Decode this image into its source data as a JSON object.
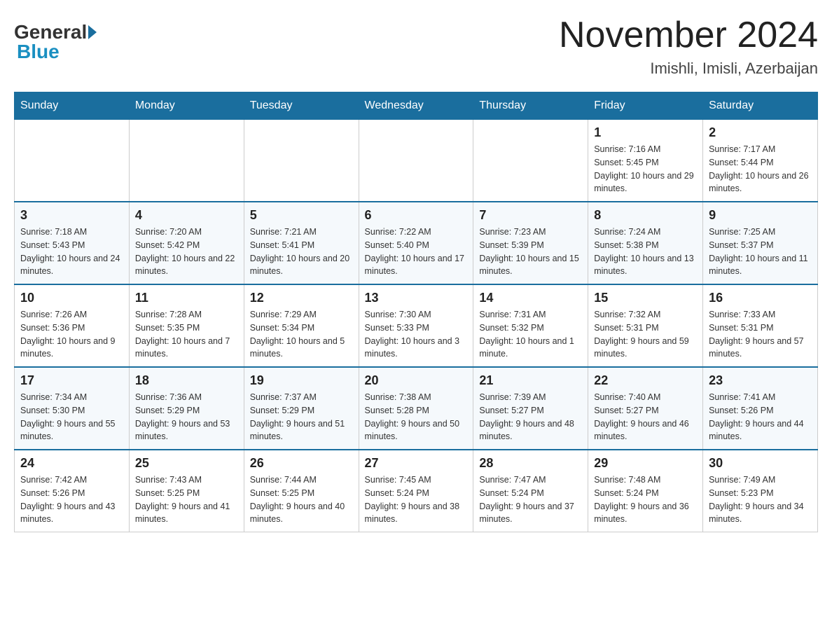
{
  "header": {
    "logo_general": "General",
    "logo_blue": "Blue",
    "title": "November 2024",
    "subtitle": "Imishli, Imisli, Azerbaijan"
  },
  "days_of_week": [
    "Sunday",
    "Monday",
    "Tuesday",
    "Wednesday",
    "Thursday",
    "Friday",
    "Saturday"
  ],
  "weeks": [
    {
      "days": [
        {
          "number": "",
          "info": ""
        },
        {
          "number": "",
          "info": ""
        },
        {
          "number": "",
          "info": ""
        },
        {
          "number": "",
          "info": ""
        },
        {
          "number": "",
          "info": ""
        },
        {
          "number": "1",
          "info": "Sunrise: 7:16 AM\nSunset: 5:45 PM\nDaylight: 10 hours and 29 minutes."
        },
        {
          "number": "2",
          "info": "Sunrise: 7:17 AM\nSunset: 5:44 PM\nDaylight: 10 hours and 26 minutes."
        }
      ]
    },
    {
      "days": [
        {
          "number": "3",
          "info": "Sunrise: 7:18 AM\nSunset: 5:43 PM\nDaylight: 10 hours and 24 minutes."
        },
        {
          "number": "4",
          "info": "Sunrise: 7:20 AM\nSunset: 5:42 PM\nDaylight: 10 hours and 22 minutes."
        },
        {
          "number": "5",
          "info": "Sunrise: 7:21 AM\nSunset: 5:41 PM\nDaylight: 10 hours and 20 minutes."
        },
        {
          "number": "6",
          "info": "Sunrise: 7:22 AM\nSunset: 5:40 PM\nDaylight: 10 hours and 17 minutes."
        },
        {
          "number": "7",
          "info": "Sunrise: 7:23 AM\nSunset: 5:39 PM\nDaylight: 10 hours and 15 minutes."
        },
        {
          "number": "8",
          "info": "Sunrise: 7:24 AM\nSunset: 5:38 PM\nDaylight: 10 hours and 13 minutes."
        },
        {
          "number": "9",
          "info": "Sunrise: 7:25 AM\nSunset: 5:37 PM\nDaylight: 10 hours and 11 minutes."
        }
      ]
    },
    {
      "days": [
        {
          "number": "10",
          "info": "Sunrise: 7:26 AM\nSunset: 5:36 PM\nDaylight: 10 hours and 9 minutes."
        },
        {
          "number": "11",
          "info": "Sunrise: 7:28 AM\nSunset: 5:35 PM\nDaylight: 10 hours and 7 minutes."
        },
        {
          "number": "12",
          "info": "Sunrise: 7:29 AM\nSunset: 5:34 PM\nDaylight: 10 hours and 5 minutes."
        },
        {
          "number": "13",
          "info": "Sunrise: 7:30 AM\nSunset: 5:33 PM\nDaylight: 10 hours and 3 minutes."
        },
        {
          "number": "14",
          "info": "Sunrise: 7:31 AM\nSunset: 5:32 PM\nDaylight: 10 hours and 1 minute."
        },
        {
          "number": "15",
          "info": "Sunrise: 7:32 AM\nSunset: 5:31 PM\nDaylight: 9 hours and 59 minutes."
        },
        {
          "number": "16",
          "info": "Sunrise: 7:33 AM\nSunset: 5:31 PM\nDaylight: 9 hours and 57 minutes."
        }
      ]
    },
    {
      "days": [
        {
          "number": "17",
          "info": "Sunrise: 7:34 AM\nSunset: 5:30 PM\nDaylight: 9 hours and 55 minutes."
        },
        {
          "number": "18",
          "info": "Sunrise: 7:36 AM\nSunset: 5:29 PM\nDaylight: 9 hours and 53 minutes."
        },
        {
          "number": "19",
          "info": "Sunrise: 7:37 AM\nSunset: 5:29 PM\nDaylight: 9 hours and 51 minutes."
        },
        {
          "number": "20",
          "info": "Sunrise: 7:38 AM\nSunset: 5:28 PM\nDaylight: 9 hours and 50 minutes."
        },
        {
          "number": "21",
          "info": "Sunrise: 7:39 AM\nSunset: 5:27 PM\nDaylight: 9 hours and 48 minutes."
        },
        {
          "number": "22",
          "info": "Sunrise: 7:40 AM\nSunset: 5:27 PM\nDaylight: 9 hours and 46 minutes."
        },
        {
          "number": "23",
          "info": "Sunrise: 7:41 AM\nSunset: 5:26 PM\nDaylight: 9 hours and 44 minutes."
        }
      ]
    },
    {
      "days": [
        {
          "number": "24",
          "info": "Sunrise: 7:42 AM\nSunset: 5:26 PM\nDaylight: 9 hours and 43 minutes."
        },
        {
          "number": "25",
          "info": "Sunrise: 7:43 AM\nSunset: 5:25 PM\nDaylight: 9 hours and 41 minutes."
        },
        {
          "number": "26",
          "info": "Sunrise: 7:44 AM\nSunset: 5:25 PM\nDaylight: 9 hours and 40 minutes."
        },
        {
          "number": "27",
          "info": "Sunrise: 7:45 AM\nSunset: 5:24 PM\nDaylight: 9 hours and 38 minutes."
        },
        {
          "number": "28",
          "info": "Sunrise: 7:47 AM\nSunset: 5:24 PM\nDaylight: 9 hours and 37 minutes."
        },
        {
          "number": "29",
          "info": "Sunrise: 7:48 AM\nSunset: 5:24 PM\nDaylight: 9 hours and 36 minutes."
        },
        {
          "number": "30",
          "info": "Sunrise: 7:49 AM\nSunset: 5:23 PM\nDaylight: 9 hours and 34 minutes."
        }
      ]
    }
  ]
}
